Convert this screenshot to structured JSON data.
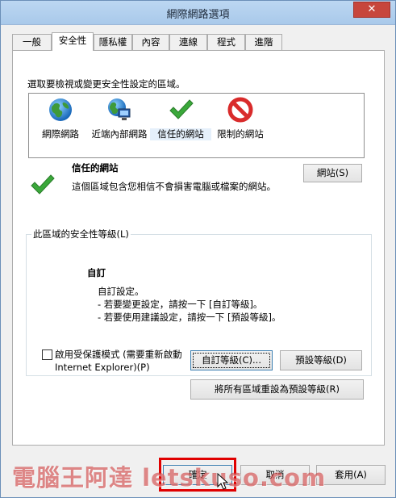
{
  "window": {
    "title": "網際網路選項",
    "close_glyph": "✕"
  },
  "tabs": [
    {
      "label": "一般",
      "active": false
    },
    {
      "label": "安全性",
      "active": true
    },
    {
      "label": "隱私權",
      "active": false
    },
    {
      "label": "內容",
      "active": false
    },
    {
      "label": "連線",
      "active": false
    },
    {
      "label": "程式",
      "active": false
    },
    {
      "label": "進階",
      "active": false
    }
  ],
  "security": {
    "instruction": "選取要檢視或變更安全性設定的區域。",
    "zones": [
      {
        "label": "網際網路",
        "icon": "globe-icon",
        "selected": false
      },
      {
        "label": "近端內部網路",
        "icon": "intranet-icon",
        "selected": false
      },
      {
        "label": "信任的網站",
        "icon": "checkmark-icon",
        "selected": true
      },
      {
        "label": "限制的網站",
        "icon": "restricted-icon",
        "selected": false
      }
    ],
    "selected_zone": {
      "title": "信任的網站",
      "description": "這個區域包含您相信不會損害電腦或檔案的網站。",
      "sites_button": "網站(S)"
    },
    "level_group": {
      "label": "此區域的安全性等級(L)",
      "level_title": "自訂",
      "line1": "自訂設定。",
      "line2": "- 若要變更設定，請按一下 [自訂等級]。",
      "line3": "- 若要使用建議設定，請按一下 [預設等級]。",
      "protected_mode_label_line1": "啟用受保護模式 (需要重新啟動",
      "protected_mode_label_line2": "Internet Explorer)(P)",
      "protected_mode_checked": false,
      "custom_level_button": "自訂等級(C)...",
      "default_level_button": "預設等級(D)"
    },
    "reset_all_button": "將所有區域重設為預設等級(R)"
  },
  "footer": {
    "ok_button": "確定",
    "cancel_button": "取消",
    "apply_button": "套用(A)"
  },
  "watermark": "電腦王阿達 letskuso.com",
  "colors": {
    "titlebar": "#b4d1ef",
    "close": "#c7463c",
    "check": "#3aa83a",
    "restricted": "#d92b2b"
  }
}
